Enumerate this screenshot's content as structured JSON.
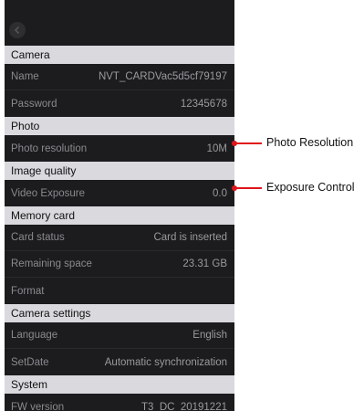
{
  "sections": {
    "camera": "Camera",
    "photo": "Photo",
    "image_quality": "Image quality",
    "memory_card": "Memory card",
    "camera_settings": "Camera settings",
    "system": "System"
  },
  "rows": {
    "name": {
      "label": "Name",
      "value": "NVT_CARDVac5d5cf79197"
    },
    "password": {
      "label": "Password",
      "value": "12345678"
    },
    "photo_resolution": {
      "label": "Photo resolution",
      "value": "10M"
    },
    "video_exposure": {
      "label": "Video Exposure",
      "value": "0.0"
    },
    "card_status": {
      "label": "Card status",
      "value": "Card is inserted"
    },
    "remaining_space": {
      "label": "Remaining space",
      "value": "23.31 GB"
    },
    "format": {
      "label": "Format"
    },
    "language": {
      "label": "Language",
      "value": "English"
    },
    "set_date": {
      "label": "SetDate",
      "value": "Automatic synchronization"
    },
    "fw_version": {
      "label": "FW version",
      "value": "T3_DC_20191221"
    }
  },
  "annotations": {
    "photo_resolution": "Photo Resolution",
    "exposure_control": "Exposure Control"
  },
  "colors": {
    "background": "#1c1c1e",
    "section_header": "#d9d9de",
    "annotation_red": "#e0151b"
  },
  "icons": {
    "back": "chevron-left-icon"
  }
}
